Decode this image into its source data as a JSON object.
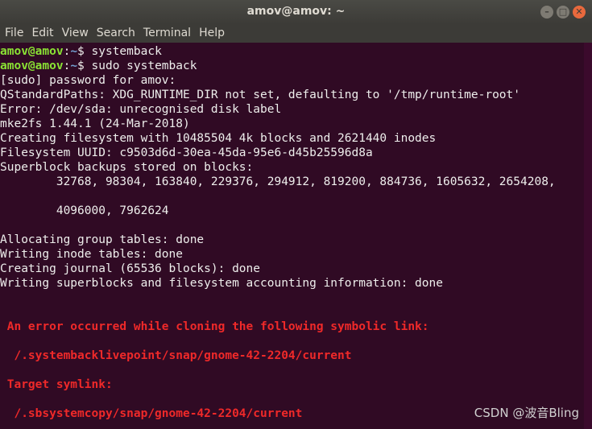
{
  "window": {
    "title": "amov@amov: ~",
    "btn_minimize": "–",
    "btn_maximize": "□",
    "btn_close": "✕"
  },
  "menu": [
    "File",
    "Edit",
    "View",
    "Search",
    "Terminal",
    "Help"
  ],
  "terminal": {
    "lines": [
      {
        "kind": "prompt",
        "user": "amov@amov",
        "path": "~",
        "cmd": " systemback"
      },
      {
        "kind": "prompt",
        "user": "amov@amov",
        "path": "~",
        "cmd": " sudo systemback"
      },
      {
        "kind": "text",
        "text": "[sudo] password for amov:"
      },
      {
        "kind": "text",
        "text": "QStandardPaths: XDG_RUNTIME_DIR not set, defaulting to '/tmp/runtime-root'"
      },
      {
        "kind": "text",
        "text": "Error: /dev/sda: unrecognised disk label"
      },
      {
        "kind": "text",
        "text": "mke2fs 1.44.1 (24-Mar-2018)"
      },
      {
        "kind": "text",
        "text": "Creating filesystem with 10485504 4k blocks and 2621440 inodes"
      },
      {
        "kind": "text",
        "text": "Filesystem UUID: c9503d6d-30ea-45da-95e6-d45b25596d8a"
      },
      {
        "kind": "text",
        "text": "Superblock backups stored on blocks:"
      },
      {
        "kind": "text",
        "text": "        32768, 98304, 163840, 229376, 294912, 819200, 884736, 1605632, 2654208,"
      },
      {
        "kind": "blank",
        "text": ""
      },
      {
        "kind": "text",
        "text": "        4096000, 7962624"
      },
      {
        "kind": "blank",
        "text": ""
      },
      {
        "kind": "text",
        "text": "Allocating group tables: done"
      },
      {
        "kind": "text",
        "text": "Writing inode tables: done"
      },
      {
        "kind": "text",
        "text": "Creating journal (65536 blocks): done"
      },
      {
        "kind": "text",
        "text": "Writing superblocks and filesystem accounting information: done"
      },
      {
        "kind": "blank",
        "text": ""
      },
      {
        "kind": "blank",
        "text": ""
      },
      {
        "kind": "error",
        "text": " An error occurred while cloning the following symbolic link:"
      },
      {
        "kind": "blank",
        "text": ""
      },
      {
        "kind": "error",
        "text": "  /.systembacklivepoint/snap/gnome-42-2204/current"
      },
      {
        "kind": "blank",
        "text": ""
      },
      {
        "kind": "error",
        "text": " Target symlink:"
      },
      {
        "kind": "blank",
        "text": ""
      },
      {
        "kind": "error",
        "text": "  /.sbsystemcopy/snap/gnome-42-2204/current"
      }
    ]
  },
  "watermark": "CSDN @波音Bling",
  "colors": {
    "background": "#300a24",
    "prompt_user": "#8ae234",
    "prompt_path": "#729fcf",
    "error_text": "#ef2929"
  }
}
